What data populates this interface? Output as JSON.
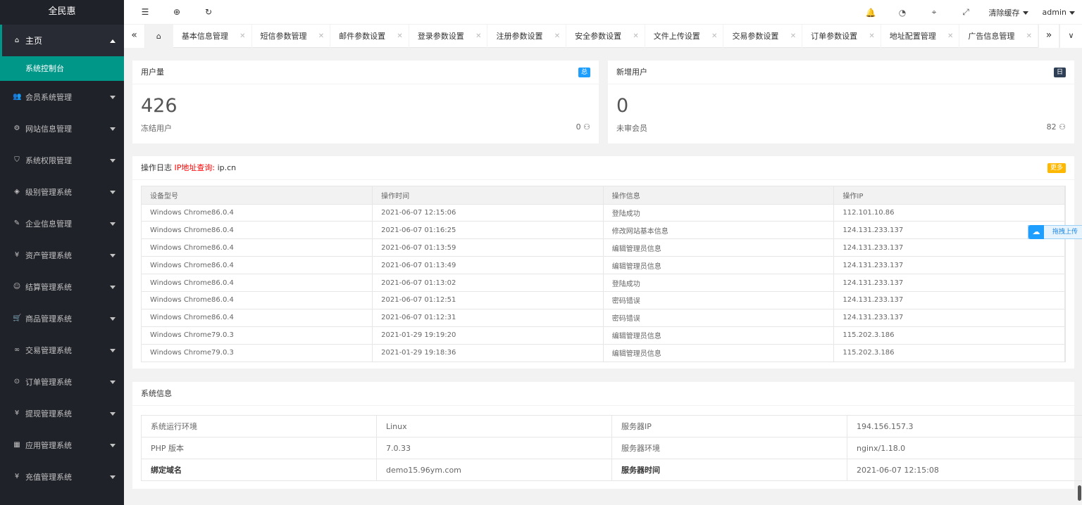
{
  "app": {
    "title": "全民惠"
  },
  "sidebar": {
    "home": {
      "label": "主页",
      "icon": "home-icon"
    },
    "home_sub": "系统控制台",
    "items": [
      {
        "label": "会员系统管理",
        "icon": "users-icon",
        "glyph": "👥"
      },
      {
        "label": "网站信息管理",
        "icon": "gear-icon",
        "glyph": "⚙"
      },
      {
        "label": "系统权限管理",
        "icon": "shield-icon",
        "glyph": "⛉"
      },
      {
        "label": "级别管理系统",
        "icon": "diamond-icon",
        "glyph": "◈"
      },
      {
        "label": "企业信息管理",
        "icon": "edit-icon",
        "glyph": "✎"
      },
      {
        "label": "资产管理系统",
        "icon": "yen-icon",
        "glyph": "¥"
      },
      {
        "label": "结算管理系统",
        "icon": "smile-icon",
        "glyph": "☺"
      },
      {
        "label": "商品管理系统",
        "icon": "cart-icon",
        "glyph": "🛒"
      },
      {
        "label": "交易管理系统",
        "icon": "link-icon",
        "glyph": "∞"
      },
      {
        "label": "订单管理系统",
        "icon": "location-icon",
        "glyph": "⊙"
      },
      {
        "label": "提现管理系统",
        "icon": "yen-icon",
        "glyph": "¥"
      },
      {
        "label": "应用管理系统",
        "icon": "apps-icon",
        "glyph": "▦"
      },
      {
        "label": "充值管理系统",
        "icon": "yen-icon",
        "glyph": "¥"
      }
    ]
  },
  "topbar": {
    "clear_cache": "清除缓存",
    "user": "admin"
  },
  "tabs": [
    "基本信息管理",
    "短信参数管理",
    "邮件参数设置",
    "登录参数设置",
    "注册参数设置",
    "安全参数设置",
    "文件上传设置",
    "交易参数设置",
    "订单参数设置",
    "地址配置管理",
    "广告信息管理"
  ],
  "stats": {
    "users": {
      "title": "用户量",
      "badge": "总",
      "badge_color": "#1e9fff",
      "value": "426",
      "sub_label": "冻结用户",
      "sub_value": "0"
    },
    "new_users": {
      "title": "新增用户",
      "badge": "日",
      "badge_color": "#2f4056",
      "value": "0",
      "sub_label": "未审会员",
      "sub_value": "82"
    }
  },
  "log": {
    "title": "操作日志",
    "ip_query": "IP地址查询:",
    "ip_site": "ip.cn",
    "more": "更多",
    "columns": [
      "设备型号",
      "操作时间",
      "操作信息",
      "操作IP"
    ],
    "rows": [
      [
        "Windows Chrome86.0.4",
        "2021-06-07 12:15:06",
        "登陆成功",
        "112.101.10.86"
      ],
      [
        "Windows Chrome86.0.4",
        "2021-06-07 01:16:25",
        "修改网站基本信息",
        "124.131.233.137"
      ],
      [
        "Windows Chrome86.0.4",
        "2021-06-07 01:13:59",
        "编辑管理员信息",
        "124.131.233.137"
      ],
      [
        "Windows Chrome86.0.4",
        "2021-06-07 01:13:49",
        "编辑管理员信息",
        "124.131.233.137"
      ],
      [
        "Windows Chrome86.0.4",
        "2021-06-07 01:13:02",
        "登陆成功",
        "124.131.233.137"
      ],
      [
        "Windows Chrome86.0.4",
        "2021-06-07 01:12:51",
        "密码错误",
        "124.131.233.137"
      ],
      [
        "Windows Chrome86.0.4",
        "2021-06-07 01:12:31",
        "密码错误",
        "124.131.233.137"
      ],
      [
        "Windows Chrome79.0.3",
        "2021-01-29 19:19:20",
        "编辑管理员信息",
        "115.202.3.186"
      ],
      [
        "Windows Chrome79.0.3",
        "2021-01-29 19:18:36",
        "编辑管理员信息",
        "115.202.3.186"
      ]
    ]
  },
  "sysinfo": {
    "title": "系统信息",
    "rows": [
      [
        "系统运行环境",
        "Linux",
        "服务器IP",
        "194.156.157.3"
      ],
      [
        "PHP 版本",
        "7.0.33",
        "服务器环境",
        "nginx/1.18.0"
      ],
      [
        "绑定域名",
        "demo15.96ym.com",
        "服务器时间",
        "2021-06-07 12:15:08"
      ]
    ]
  },
  "upload_float": "拖拽上传"
}
